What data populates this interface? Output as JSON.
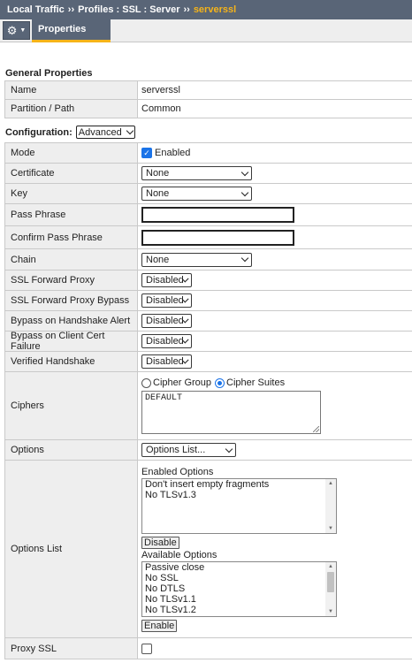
{
  "breadcrumb": {
    "items": [
      "Local Traffic",
      "Profiles : SSL : Server"
    ],
    "separator": "››",
    "current": "serverssl"
  },
  "tabs": {
    "menu_icon": "gear-icon",
    "properties": "Properties"
  },
  "general": {
    "title": "General Properties",
    "rows": [
      {
        "label": "Name",
        "value": "serverssl"
      },
      {
        "label": "Partition / Path",
        "value": "Common"
      }
    ]
  },
  "configuration": {
    "label": "Configuration:",
    "mode_select": "Advanced",
    "mode": {
      "label": "Mode",
      "checkbox_label": "Enabled",
      "checked": true
    },
    "certificate": {
      "label": "Certificate",
      "value": "None"
    },
    "key": {
      "label": "Key",
      "value": "None"
    },
    "pass_phrase": {
      "label": "Pass Phrase",
      "value": ""
    },
    "confirm_pass_phrase": {
      "label": "Confirm Pass Phrase",
      "value": ""
    },
    "chain": {
      "label": "Chain",
      "value": "None"
    },
    "ssl_forward_proxy": {
      "label": "SSL Forward Proxy",
      "value": "Disabled"
    },
    "ssl_forward_proxy_bypass": {
      "label": "SSL Forward Proxy Bypass",
      "value": "Disabled"
    },
    "bypass_handshake_alert": {
      "label": "Bypass on Handshake Alert",
      "value": "Disabled"
    },
    "bypass_client_cert_failure": {
      "label": "Bypass on Client Cert Failure",
      "value": "Disabled"
    },
    "verified_handshake": {
      "label": "Verified Handshake",
      "value": "Disabled"
    },
    "ciphers": {
      "label": "Ciphers",
      "radio_group": "Cipher Group",
      "radio_suites": "Cipher Suites",
      "selected": "Cipher Suites",
      "value": "DEFAULT"
    },
    "options": {
      "label": "Options",
      "value": "Options List..."
    },
    "options_list": {
      "label": "Options List",
      "enabled_title": "Enabled Options",
      "enabled": [
        "Don't insert empty fragments",
        "No TLSv1.3"
      ],
      "disable_button": "Disable",
      "available_title": "Available Options",
      "available": [
        "Passive close",
        "No SSL",
        "No DTLS",
        "No TLSv1.1",
        "No TLSv1.2"
      ],
      "enable_button": "Enable"
    },
    "proxy_ssl": {
      "label": "Proxy SSL",
      "checked": false
    }
  },
  "colors": {
    "breadcrumb_bg": "#596577",
    "accent": "#f6b419",
    "label_bg": "#eeeeee"
  }
}
